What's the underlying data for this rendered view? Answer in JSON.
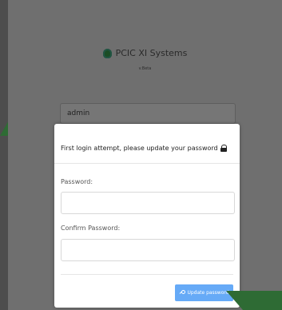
{
  "app": {
    "brand": "PCIC XI Systems",
    "version": "v.Beta"
  },
  "login": {
    "username": "admin"
  },
  "modal": {
    "title": "First login attempt, please update your password",
    "password_label": "Password:",
    "confirm_label": "Confirm Password:",
    "update_button": "Update password"
  },
  "icons": {
    "lock": "lock-icon",
    "key": "key-icon",
    "logo": "logo-icon"
  },
  "colors": {
    "accent": "#66aaf7",
    "background": "#4d4d4d",
    "brand_green": "#2e6b34"
  }
}
